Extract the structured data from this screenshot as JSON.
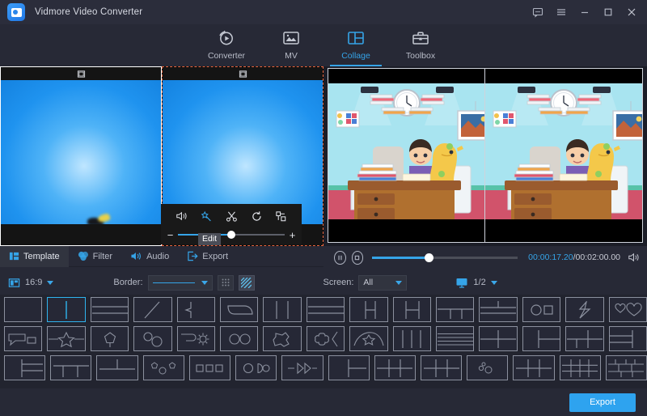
{
  "window": {
    "app_title": "Vidmore Video Converter",
    "controls": [
      {
        "name": "feedback-icon",
        "label": "feedback"
      },
      {
        "name": "menu-icon",
        "label": "menu"
      },
      {
        "name": "minimize-icon",
        "label": "minimize"
      },
      {
        "name": "maximize-icon",
        "label": "maximize"
      },
      {
        "name": "close-icon",
        "label": "close"
      }
    ]
  },
  "nav": {
    "items": [
      {
        "label": "Converter",
        "icon": "converter-icon",
        "active": false
      },
      {
        "label": "MV",
        "icon": "mv-icon",
        "active": false
      },
      {
        "label": "Collage",
        "icon": "collage-icon",
        "active": true
      },
      {
        "label": "Toolbox",
        "icon": "toolbox-icon",
        "active": false
      }
    ]
  },
  "editor": {
    "cells": [
      {
        "name": "collage-cell-1",
        "selected": false,
        "badge": "film-strip-icon"
      },
      {
        "name": "collage-cell-2",
        "selected": true,
        "badge": "film-strip-icon"
      }
    ],
    "edit_toolbar": {
      "tooltip": "Edit",
      "icons": [
        {
          "name": "volume-icon",
          "label": "Volume"
        },
        {
          "name": "magic-wand-icon",
          "label": "Edit"
        },
        {
          "name": "scissors-icon",
          "label": "Trim"
        },
        {
          "name": "rotate-icon",
          "label": "Rotate"
        },
        {
          "name": "crop-icon",
          "label": "Crop"
        }
      ],
      "minus": "−",
      "plus": "+",
      "slider_value": 46
    }
  },
  "player": {
    "pause_icon": "pause-icon",
    "stop_icon": "stop-icon",
    "current_time": "00:00:17.20",
    "separator": "/",
    "total_time": "00:02:00.00",
    "volume_icon": "volume-icon",
    "progress": 36
  },
  "tabs": [
    {
      "label": "Template",
      "icon": "template-icon",
      "active": true
    },
    {
      "label": "Filter",
      "icon": "filter-icon",
      "active": false
    },
    {
      "label": "Audio",
      "icon": "audio-icon",
      "active": false
    },
    {
      "label": "Export",
      "icon": "export-icon",
      "active": false
    }
  ],
  "options": {
    "aspect_icon": "aspect-ratio-icon",
    "aspect_value": "16:9",
    "border_label": "Border:",
    "border_style": "solid-line",
    "border_dots_icon": "dotted-pattern-icon",
    "border_stripe_icon": "striped-pattern-icon",
    "screen_label": "Screen:",
    "screen_value": "All",
    "screen_options": [
      "All"
    ],
    "page_icon": "monitor-icon",
    "page_value": "1/2"
  },
  "templates": {
    "selected_index": 1,
    "rows": [
      [
        {
          "name": "template-single"
        },
        {
          "name": "template-two-vertical"
        },
        {
          "name": "template-two-horizontal"
        },
        {
          "name": "template-diagonal-split"
        },
        {
          "name": "template-arrow-notch"
        },
        {
          "name": "template-rounded-inset"
        },
        {
          "name": "template-three-columns"
        },
        {
          "name": "template-three-rows"
        },
        {
          "name": "template-left-big-two-right"
        },
        {
          "name": "template-center-split"
        },
        {
          "name": "template-top-bottom-split"
        },
        {
          "name": "template-bottom-two"
        },
        {
          "name": "template-circle-square"
        },
        {
          "name": "template-lightning"
        },
        {
          "name": "template-two-hearts"
        }
      ],
      [
        {
          "name": "template-speech-bubble"
        },
        {
          "name": "template-star-band"
        },
        {
          "name": "template-pentagon"
        },
        {
          "name": "template-two-circles"
        },
        {
          "name": "template-tag-sun"
        },
        {
          "name": "template-double-circle"
        },
        {
          "name": "template-puzzle"
        },
        {
          "name": "template-flower-notch"
        },
        {
          "name": "template-arch-star"
        },
        {
          "name": "template-four-columns"
        },
        {
          "name": "template-five-rows"
        },
        {
          "name": "template-quad"
        },
        {
          "name": "template-left-two-right-split"
        },
        {
          "name": "template-three-mixed"
        },
        {
          "name": "template-rows-and-column"
        }
      ],
      [
        {
          "name": "template-left-big-three-rows"
        },
        {
          "name": "template-top-bar-three"
        },
        {
          "name": "template-two-top-one-bottom"
        },
        {
          "name": "template-three-hex"
        },
        {
          "name": "template-three-squares"
        },
        {
          "name": "template-circle-pac-circle"
        },
        {
          "name": "template-arrows"
        },
        {
          "name": "template-left-right-split"
        },
        {
          "name": "template-six-grid"
        },
        {
          "name": "template-grid-2x3"
        },
        {
          "name": "template-bubbles"
        },
        {
          "name": "template-six-cells"
        },
        {
          "name": "template-nine-grid"
        },
        {
          "name": "template-mixed-grid"
        }
      ]
    ]
  },
  "footer": {
    "export_label": "Export"
  },
  "colors": {
    "accent": "#2ea3ef",
    "accent_text": "#35a4e8",
    "background": "#272936",
    "panel": "#22242f",
    "selection_border": "#e8643c",
    "template_selected": "#2fb4ef"
  }
}
